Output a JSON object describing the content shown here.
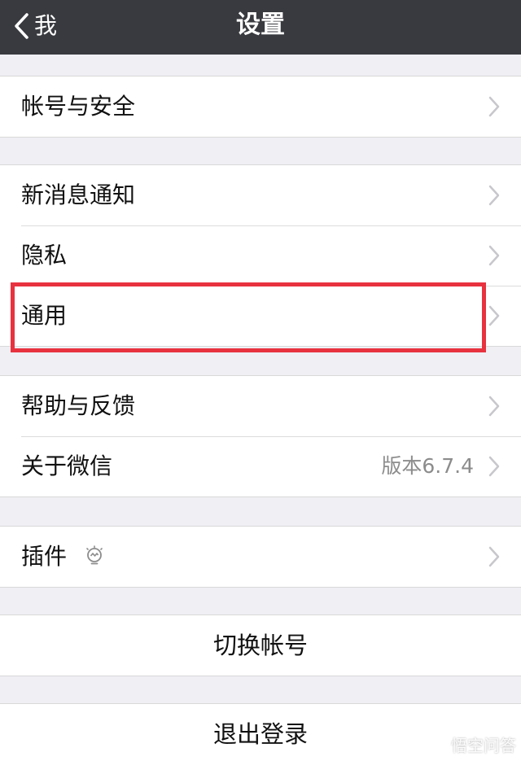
{
  "navbar": {
    "back_label": "我",
    "title": "设置"
  },
  "groups": {
    "account": {
      "items": [
        {
          "label": "帐号与安全"
        }
      ]
    },
    "main": {
      "items": [
        {
          "label": "新消息通知"
        },
        {
          "label": "隐私"
        },
        {
          "label": "通用"
        }
      ]
    },
    "help": {
      "items": [
        {
          "label": "帮助与反馈"
        },
        {
          "label": "关于微信",
          "value": "版本6.7.4"
        }
      ]
    },
    "plugins": {
      "items": [
        {
          "label": "插件",
          "icon": "lightbulb-icon"
        }
      ]
    }
  },
  "actions": {
    "switch_account": "切换帐号",
    "logout": "退出登录"
  },
  "annotation": {
    "highlight_color": "#e8323f"
  },
  "watermark": {
    "text": "悟空问答"
  },
  "colors": {
    "navbar_bg": "#393a3f",
    "page_bg": "#efeff4",
    "cell_bg": "#ffffff"
  }
}
